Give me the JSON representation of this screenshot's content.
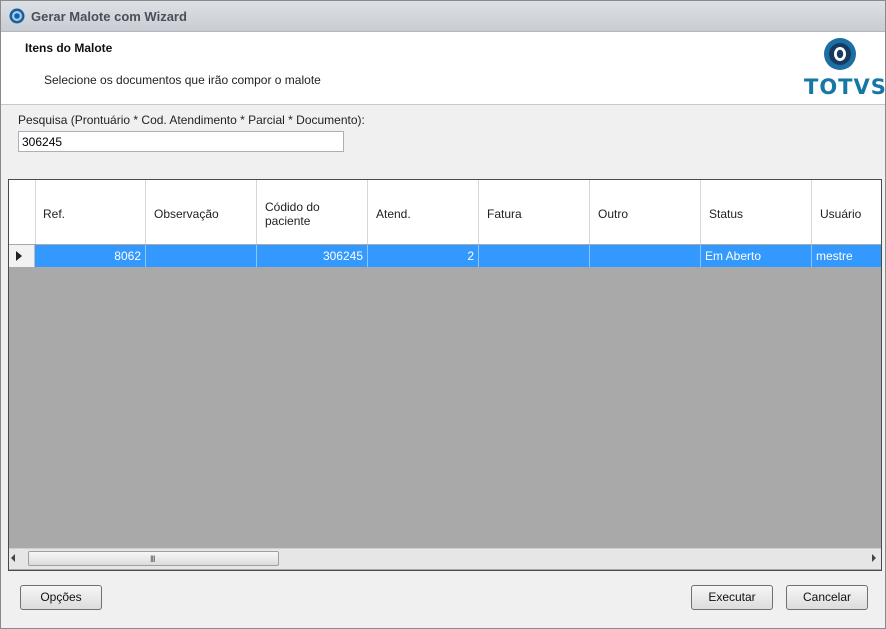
{
  "window": {
    "title": "Gerar Malote com Wizard"
  },
  "header": {
    "title": "Itens do Malote",
    "subtitle": "Selecione os documentos que irão compor o malote",
    "logo_text": "TOTVS",
    "logo_color": "#1677a6"
  },
  "search": {
    "label": "Pesquisa (Prontuário * Cod. Atendimento * Parcial * Documento):",
    "value": "306245"
  },
  "grid": {
    "columns": [
      "Ref.",
      "Observação",
      "Códido do paciente",
      "Atend.",
      "Fatura",
      "Outro",
      "Status",
      "Usuário"
    ],
    "rows": [
      {
        "ref": "8062",
        "observacao": "",
        "codigo": "306245",
        "atend": "2",
        "fatura": "",
        "outro": "",
        "status": "Em Aberto",
        "usuario": "mestre"
      }
    ],
    "selection_color": "#3399ff",
    "scrollbar_grip": "III"
  },
  "footer": {
    "options_label": "Opções",
    "execute_label": "Executar",
    "cancel_label": "Cancelar"
  }
}
